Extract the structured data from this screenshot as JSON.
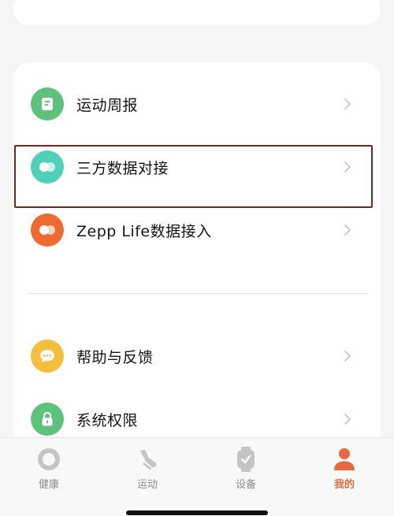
{
  "menu": {
    "items": [
      {
        "label": "运动周报",
        "icon": "report-icon",
        "color": "#5dc27b"
      },
      {
        "label": "三方数据对接",
        "icon": "link-toggle-icon",
        "color": "#4fd0b8"
      },
      {
        "label": "Zepp Life数据接入",
        "icon": "link-toggle-icon",
        "color": "#ee6a30"
      },
      {
        "label": "帮助与反馈",
        "icon": "chat-icon",
        "color": "#f5be3b"
      },
      {
        "label": "系统权限",
        "icon": "lock-icon",
        "color": "#5dc27b"
      }
    ]
  },
  "tabbar": {
    "tabs": [
      {
        "label": "健康",
        "icon": "ring-icon",
        "active": false
      },
      {
        "label": "运动",
        "icon": "shoe-icon",
        "active": false
      },
      {
        "label": "设备",
        "icon": "watch-icon",
        "active": false
      },
      {
        "label": "我的",
        "icon": "person-icon",
        "active": true
      }
    ],
    "active_color": "#e8693d"
  }
}
